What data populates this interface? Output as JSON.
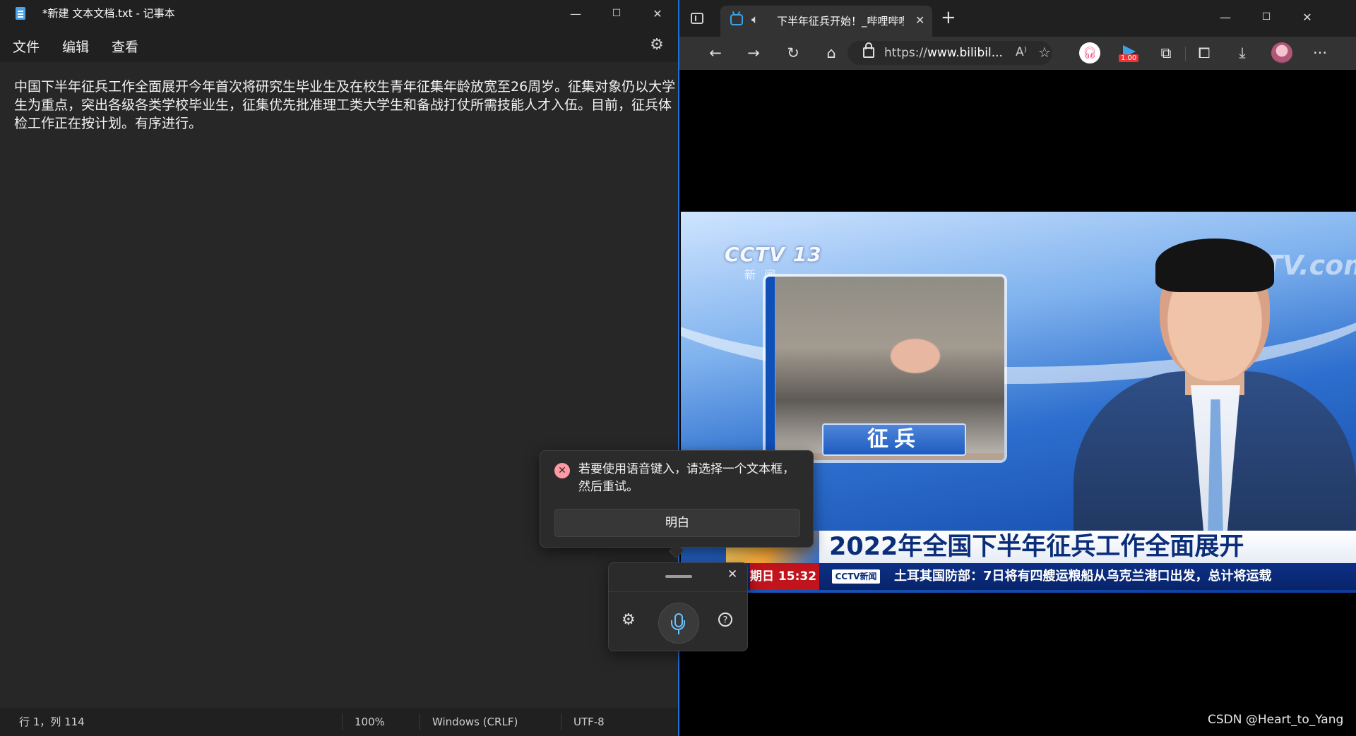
{
  "notepad": {
    "title": "*新建 文本文档.txt - 记事本",
    "window_controls": {
      "minimize": "—",
      "maximize": "☐",
      "close": "✕"
    },
    "menu": {
      "file": "文件",
      "edit": "编辑",
      "view": "查看"
    },
    "content": "中国下半年征兵工作全面展开今年首次将研究生毕业生及在校生青年征集年龄放宽至26周岁。征集对象仍以大学生为重点，突出各级各类学校毕业生，征集优先批准理工类大学生和备战打仗所需技能人才入伍。目前，征兵体检工作正在按计划。有序进行。",
    "status": {
      "position": "行 1，列 114",
      "zoom": "100%",
      "line_ending": "Windows (CRLF)",
      "encoding": "UTF-8"
    }
  },
  "browser": {
    "tab": {
      "title": "下半年征兵开始！_哔哩哔哩",
      "close": "✕"
    },
    "new_tab": "+",
    "window_controls": {
      "minimize": "—",
      "maximize": "☐",
      "close": "✕"
    },
    "address": {
      "prefix": "https://",
      "host": "www.bilibil..."
    },
    "read_aloud": "A⁾",
    "extension_badge": "1.00",
    "more": "···"
  },
  "video": {
    "channel_logo": "CCTV 13",
    "channel_sub": "新闻",
    "watermark_logo": "CCTV.com",
    "inset_label": "征兵",
    "headline": "2022年全国下半年征兵工作全面展开",
    "ticker_time": "期日  15:32",
    "ticker_badge": "CCTV新闻",
    "ticker_text": "土耳其国防部：7日将有四艘运粮船从乌克兰港口出发，总计将运载"
  },
  "voice_typing": {
    "error_message": "若要使用语音键入，请选择一个文本框，然后重试。",
    "ok_button": "明白",
    "close": "✕",
    "help": "?"
  },
  "page_watermark": "CSDN @Heart_to_Yang",
  "colors": {
    "notepad_bg": "#272727",
    "chrome_bg": "#202020",
    "browser_toolbar": "#333333",
    "accent_blue": "#1f6fd8",
    "error_pink": "#ff99a4",
    "mic_blue": "#6cc4ff"
  }
}
